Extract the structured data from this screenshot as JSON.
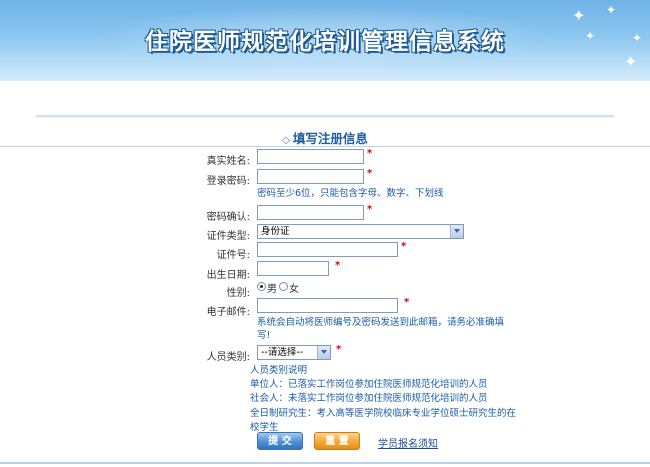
{
  "header": {
    "title": "住院医师规范化培训管理信息系统"
  },
  "form": {
    "section_title": "填写注册信息",
    "required_mark": "*",
    "real_name": {
      "label": "真实姓名:",
      "value": ""
    },
    "password": {
      "label": "登录密码:",
      "value": "",
      "hint": "密码至少6位，只能包含字母、数字、下划线"
    },
    "password_confirm": {
      "label": "密码确认:",
      "value": ""
    },
    "id_type": {
      "label": "证件类型:",
      "selected": "身份证"
    },
    "id_number": {
      "label": "证件号:",
      "value": ""
    },
    "birth_date": {
      "label": "出生日期:",
      "value": ""
    },
    "gender": {
      "label": "性别:",
      "options": [
        "男",
        "女"
      ],
      "selected": "男"
    },
    "email": {
      "label": "电子邮件:",
      "value": "",
      "hint_line1": "系统会自动将医师编号及密码发送到此邮箱，请务必准确填",
      "hint_line2": "写!"
    },
    "person_type": {
      "label": "人员类别:",
      "selected": "--请选择--"
    },
    "type_notes": {
      "title": "人员类别说明",
      "unit": "单位人：已落实工作岗位参加住院医师规范化培训的人员",
      "social": "社会人：未落实工作岗位参加住院医师规范化培训的人员",
      "fulltime_line1": "全日制研究生：考入高等医学院校临床专业学位硕士研究生的在",
      "fulltime_line2": "校学生"
    },
    "submit_label": "提 交",
    "reset_label": "重 置",
    "notice_link": "学员报名须知"
  }
}
